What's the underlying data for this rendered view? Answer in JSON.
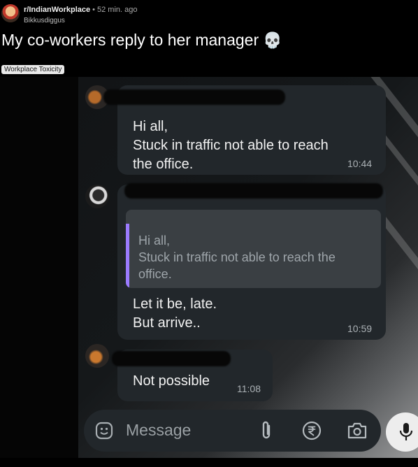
{
  "post": {
    "subreddit": "r/IndianWorkplace",
    "separator": "•",
    "time_ago": "52 min. ago",
    "author": "Bikkusdiggus",
    "title": "My co-workers reply to her manager",
    "title_icon": "skull-icon",
    "flair": "Workplace Toxicity"
  },
  "chat": {
    "messages": [
      {
        "text": "Hi all,\nStuck in traffic not able to reach\nthe office.",
        "time": "10:44"
      },
      {
        "quote": "Hi all,\nStuck in traffic not able to reach the\noffice.",
        "text": "Let it be, late.\nBut arrive..",
        "time": "10:59"
      },
      {
        "text": "Not possible",
        "time": "11:08"
      }
    ],
    "input": {
      "placeholder": "Message",
      "icons": [
        "emoji-icon",
        "attach-icon",
        "rupee-icon",
        "camera-icon",
        "mic-icon"
      ]
    },
    "colors": {
      "bubble": "#22272b",
      "quote_bar": "#9b7bff",
      "quote_bg": "#3a3f43"
    }
  }
}
